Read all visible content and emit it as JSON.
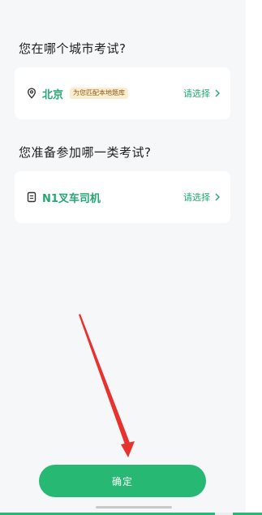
{
  "city_section": {
    "question": "您在哪个城市考试?",
    "value": "北京",
    "tag": "为您匹配本地题库",
    "action_label": "请选择"
  },
  "type_section": {
    "question": "您准备参加哪一类考试?",
    "value": "N1叉车司机",
    "action_label": "请选择"
  },
  "confirm_label": "确定",
  "colors": {
    "accent": "#27b874",
    "accent_text": "#25a870",
    "tag_bg": "#fbeecf",
    "annotation_arrow": "#e8322e"
  },
  "icons": [
    "location-pin-icon",
    "document-icon",
    "chevron-right-icon"
  ]
}
